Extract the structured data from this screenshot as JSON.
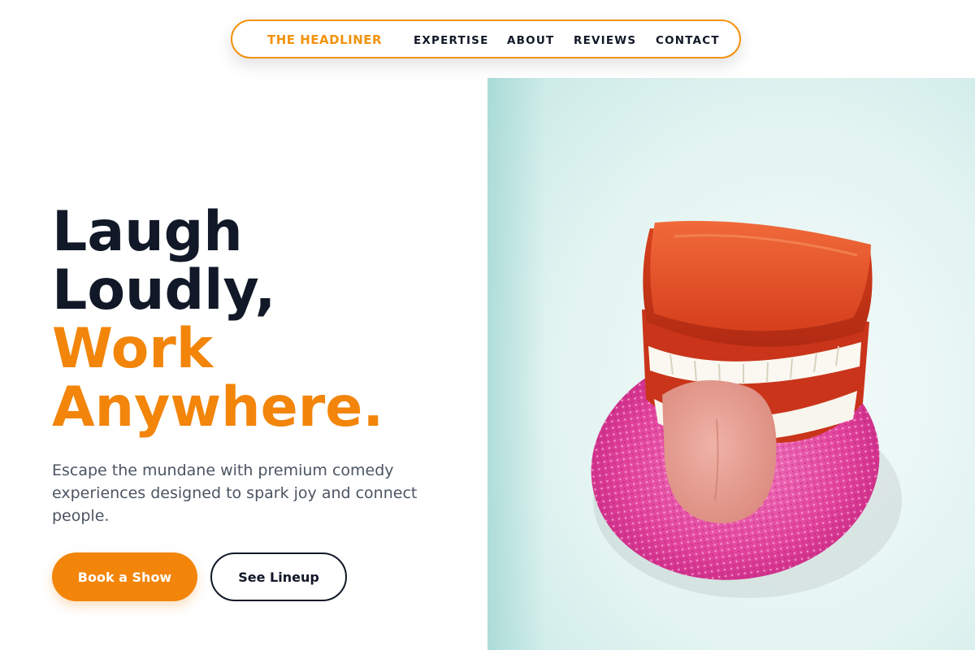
{
  "nav": {
    "brand": "THE HEADLINER",
    "links": [
      "EXPERTISE",
      "ABOUT",
      "REVIEWS",
      "CONTACT"
    ]
  },
  "hero": {
    "title_line1": "Laugh",
    "title_line2": "Loudly,",
    "title_line3": "Work",
    "title_line4": "Anywhere.",
    "subtitle": "Escape the mundane with premium comedy experiences designed to spark joy and connect people.",
    "primary_button": "Book a Show",
    "secondary_button": "See Lineup",
    "image_alt": "Chattering wind-up teeth toy with tongue out on pink sponge"
  },
  "colors": {
    "accent": "#f2850a",
    "text_dark": "#111827",
    "text_muted": "#4b5563"
  }
}
